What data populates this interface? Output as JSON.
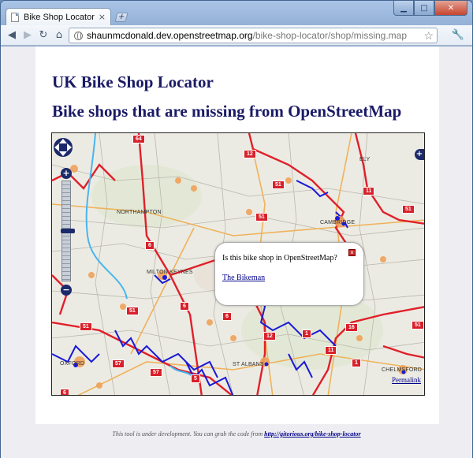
{
  "browser": {
    "tab_title": "Bike Shop Locator",
    "tab_close": "×",
    "new_tab": "+",
    "url_host": "shaunmcdonald.dev.openstreetmap.org",
    "url_path": "/bike-shop-locator/shop/missing.map"
  },
  "page": {
    "site_title": "UK Bike Shop Locator",
    "heading": "Bike shops that are missing from OpenStreetMap"
  },
  "map": {
    "place_labels": {
      "northampton": "NORTHAMPTON",
      "milton_keynes": "MILTON KEYNES",
      "cambridge": "CAMBRIDGE",
      "st_albans": "ST ALBANS",
      "oxford": "OXFORD",
      "chelmsford": "CHELMSFORD",
      "ely": "ELY"
    },
    "road_shields": [
      "64",
      "12",
      "51",
      "11",
      "51",
      "51",
      "6",
      "51",
      "6",
      "51",
      "6",
      "12",
      "1",
      "16",
      "51",
      "57",
      "57",
      "5",
      "6",
      "1",
      "11",
      "11",
      "12"
    ],
    "zoom_in": "+",
    "zoom_out": "−",
    "layer_switcher": "+",
    "permalink": "Permalink",
    "popup": {
      "close": "×",
      "question": "Is this bike shop in OpenStreetMap?",
      "shop_link": "The Bikeman"
    }
  },
  "footer": {
    "text": "This tool is under development. You can grab the code from ",
    "link": "http://gitorious.org/bike-shop-locator"
  }
}
